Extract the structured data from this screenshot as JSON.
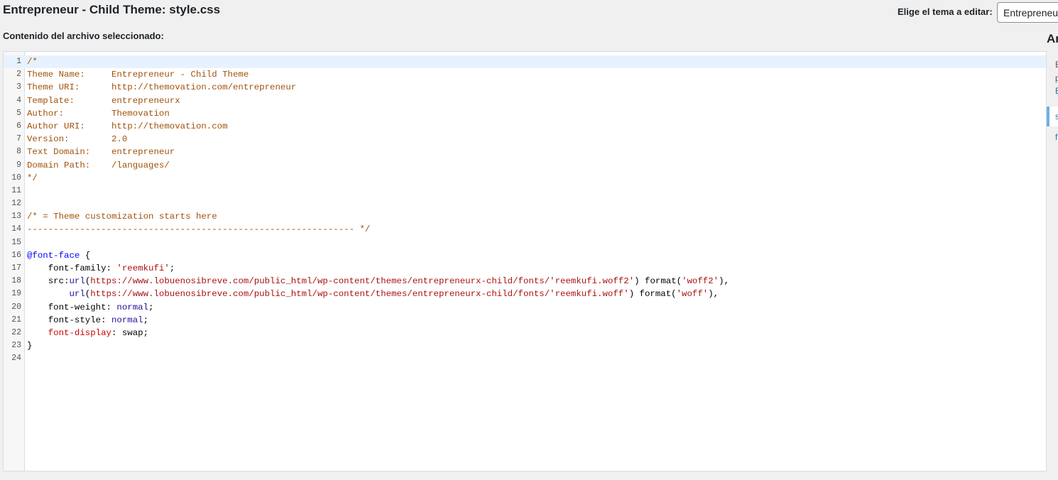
{
  "header": {
    "file_title": "Entrepreneur - Child Theme: style.css",
    "theme_select_label": "Elige el tema a editar:",
    "theme_select_value": "Entrepreneur",
    "content_label": "Contenido del archivo seleccionado:"
  },
  "sidebar": {
    "heading": "Ar",
    "desc_line1": "E",
    "desc_line2": "p",
    "link": "E",
    "active_file": "s",
    "file2": "f"
  },
  "colors": {
    "comment": "#a0520a",
    "keyword": "#0000ff",
    "string": "#aa1111",
    "atom": "#221199",
    "error": "#cc0000",
    "active_line": "#e8f2ff",
    "active_file_border": "#72aee6"
  },
  "editor": {
    "active_line": 1,
    "lines": [
      [
        {
          "t": "/*",
          "c": "comment"
        }
      ],
      [
        {
          "t": "Theme Name:     Entrepreneur - Child Theme",
          "c": "comment"
        }
      ],
      [
        {
          "t": "Theme URI:      http://themovation.com/entrepreneur",
          "c": "comment"
        }
      ],
      [
        {
          "t": "Template:       entrepreneurx",
          "c": "comment"
        }
      ],
      [
        {
          "t": "Author:         Themovation",
          "c": "comment"
        }
      ],
      [
        {
          "t": "Author URI:     http://themovation.com",
          "c": "comment"
        }
      ],
      [
        {
          "t": "Version:        2.0",
          "c": "comment"
        }
      ],
      [
        {
          "t": "Text Domain:    entrepreneur",
          "c": "comment"
        }
      ],
      [
        {
          "t": "Domain Path:    /languages/",
          "c": "comment"
        }
      ],
      [
        {
          "t": "*/",
          "c": "comment"
        }
      ],
      [],
      [],
      [
        {
          "t": "/* = Theme customization starts here",
          "c": "comment"
        }
      ],
      [
        {
          "t": "-------------------------------------------------------------- */",
          "c": "comment"
        }
      ],
      [],
      [
        {
          "t": "@font-face",
          "c": "def"
        },
        {
          "t": " {",
          "c": "punct"
        }
      ],
      [
        {
          "t": "    font-family",
          "c": "prop"
        },
        {
          "t": ": ",
          "c": "punct"
        },
        {
          "t": "'reemkufi'",
          "c": "str"
        },
        {
          "t": ";",
          "c": "punct"
        }
      ],
      [
        {
          "t": "    src",
          "c": "prop"
        },
        {
          "t": ":",
          "c": "punct"
        },
        {
          "t": "url",
          "c": "atom"
        },
        {
          "t": "(",
          "c": "punct"
        },
        {
          "t": "https://www.lobuenosibreve.com/public_html/wp-content/themes/entrepreneurx-child/fonts/",
          "c": "str"
        },
        {
          "t": "'reemkufi.woff2'",
          "c": "str"
        },
        {
          "t": ") format(",
          "c": "punct"
        },
        {
          "t": "'woff2'",
          "c": "str"
        },
        {
          "t": "),",
          "c": "punct"
        }
      ],
      [
        {
          "t": "        url",
          "c": "atom"
        },
        {
          "t": "(",
          "c": "punct"
        },
        {
          "t": "https://www.lobuenosibreve.com/public_html/wp-content/themes/entrepreneurx-child/fonts/",
          "c": "str"
        },
        {
          "t": "'reemkufi.woff'",
          "c": "str"
        },
        {
          "t": ") format(",
          "c": "punct"
        },
        {
          "t": "'woff'",
          "c": "str"
        },
        {
          "t": "),",
          "c": "punct"
        }
      ],
      [
        {
          "t": "    font-weight",
          "c": "prop"
        },
        {
          "t": ": ",
          "c": "punct"
        },
        {
          "t": "normal",
          "c": "atom"
        },
        {
          "t": ";",
          "c": "punct"
        }
      ],
      [
        {
          "t": "    font-style",
          "c": "prop"
        },
        {
          "t": ": ",
          "c": "punct"
        },
        {
          "t": "normal",
          "c": "atom"
        },
        {
          "t": ";",
          "c": "punct"
        }
      ],
      [
        {
          "t": "    ",
          "c": "punct"
        },
        {
          "t": "font-display",
          "c": "err"
        },
        {
          "t": ": swap;",
          "c": "punct"
        }
      ],
      [
        {
          "t": "}",
          "c": "punct"
        }
      ],
      []
    ]
  }
}
